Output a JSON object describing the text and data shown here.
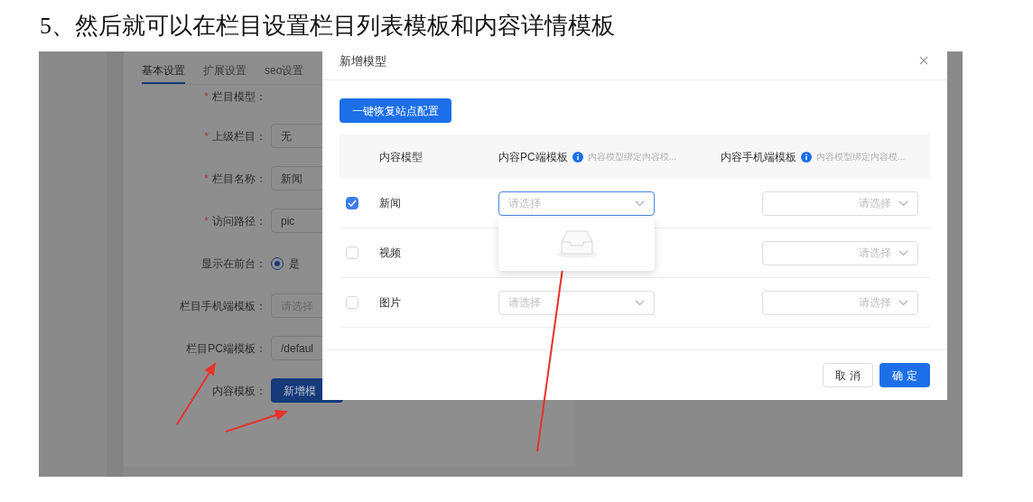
{
  "heading": "5、然后就可以在栏目设置栏目列表模板和内容详情模板",
  "background_form": {
    "tabs": [
      {
        "label": "基本设置",
        "selected": true
      },
      {
        "label": "扩展设置",
        "selected": false
      },
      {
        "label": "seo设置",
        "selected": false
      }
    ],
    "fields": [
      {
        "kind": "text",
        "label": "栏目模型：",
        "required_mark": "*"
      },
      {
        "kind": "input",
        "label": "上级栏目：",
        "required_mark": "*",
        "value": "无"
      },
      {
        "kind": "input",
        "label": "栏目名称：",
        "required_mark": "*",
        "value": "新闻"
      },
      {
        "kind": "input",
        "label": "访问路径：",
        "required_mark": "*",
        "value": "pic"
      },
      {
        "kind": "radio",
        "label": "显示在前台：",
        "value": "是",
        "selected": true
      },
      {
        "kind": "input",
        "label": "栏目手机端模板：",
        "placeholder": "请选择"
      },
      {
        "kind": "input",
        "label": "栏目PC端模板：",
        "value": "/defaul"
      },
      {
        "kind": "button",
        "label": "内容模板：",
        "value": "新增模"
      }
    ]
  },
  "dialog": {
    "title": "新增模型",
    "restore_button": "一键恢复站点配置",
    "columns": [
      {
        "label": "内容模型"
      },
      {
        "label": "内容PC端模板",
        "hint": "内容模型绑定内容模..."
      },
      {
        "label": "内容手机端模板",
        "hint": "内容模型绑定内容模..."
      }
    ],
    "rows": [
      {
        "name": "新闻",
        "checked": true,
        "pc_select": {
          "placeholder": "请选择",
          "expanded": true
        },
        "mobile_select": {
          "placeholder": "请选择"
        }
      },
      {
        "name": "视频",
        "checked": false,
        "pc_select": null,
        "mobile_select": {
          "placeholder": "请选择"
        }
      },
      {
        "name": "图片",
        "checked": false,
        "pc_select": {
          "placeholder": "请选择",
          "expanded": false
        },
        "mobile_select": {
          "placeholder": "请选择"
        }
      }
    ],
    "buttons": [
      {
        "label": "取 消",
        "kind": "secondary"
      },
      {
        "label": "确 定",
        "kind": "primary"
      }
    ]
  }
}
